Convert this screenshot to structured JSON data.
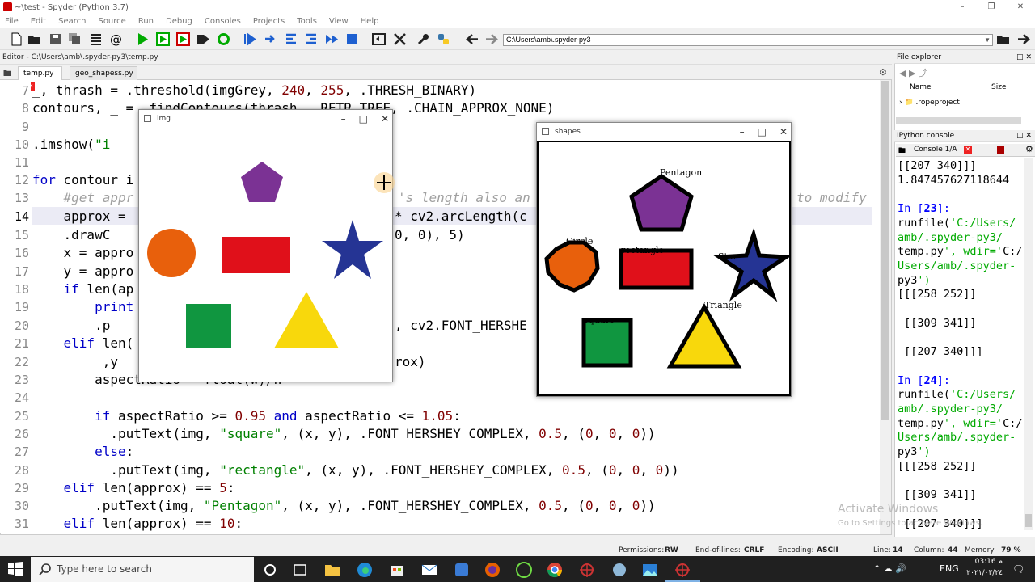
{
  "window": {
    "title": "~\\test - Spyder (Python 3.7)"
  },
  "menu": [
    "File",
    "Edit",
    "Search",
    "Source",
    "Run",
    "Debug",
    "Consoles",
    "Projects",
    "Tools",
    "View",
    "Help"
  ],
  "path": {
    "value": "C:\\Users\\amb\\.spyder-py3"
  },
  "editor": {
    "header": "Editor - C:\\Users\\amb\\.spyder-py3\\temp.py",
    "tabs": [
      "temp.py",
      "geo_shapess.py"
    ],
    "lines": [
      {
        "n": "7",
        "text": "_, thrash = cv2.threshold(imgGrey, 240, 255, cv2.THRESH_BINARY)"
      },
      {
        "n": "8",
        "text": "contours, _ = cv2.findContours(thrash, cv2.RETR_TREE, cv2.CHAIN_APPROX_NONE)"
      },
      {
        "n": "9",
        "text": ""
      },
      {
        "n": "10",
        "text": "cv2.imshow(\"i"
      },
      {
        "n": "11",
        "text": ""
      },
      {
        "n": "12",
        "text": "for contour i"
      },
      {
        "n": "13",
        "text": "    #get appr"
      },
      {
        "n": "14",
        "text": "    approx = "
      },
      {
        "n": "15",
        "text": "    cv2.drawC"
      },
      {
        "n": "16",
        "text": "    x = appro"
      },
      {
        "n": "17",
        "text": "    y = appro"
      },
      {
        "n": "18",
        "text": "    if len(ap"
      },
      {
        "n": "19",
        "text": "        print"
      },
      {
        "n": "20",
        "text": "        cv2.p"
      },
      {
        "n": "21",
        "text": "    elif len("
      },
      {
        "n": "22",
        "text": "        x1 ,y"
      },
      {
        "n": "23",
        "text": "        aspectRatio = float(w)/h"
      },
      {
        "n": "24",
        "text": ""
      },
      {
        "n": "25",
        "text": "        if aspectRatio >= 0.95 and aspectRatio <= 1.05:"
      },
      {
        "n": "26",
        "text": "          cv2.putText(img, \"square\", (x, y), cv2.FONT_HERSHEY_COMPLEX, 0.5, (0, 0, 0))"
      },
      {
        "n": "27",
        "text": "        else:"
      },
      {
        "n": "28",
        "text": "          cv2.putText(img, \"rectangle\", (x, y), cv2.FONT_HERSHEY_COMPLEX, 0.5, (0, 0, 0))"
      },
      {
        "n": "29",
        "text": "    elif len(approx) == 5:"
      },
      {
        "n": "30",
        "text": "        cv2.putText(img, \"Pentagon\", (x, y), cv2.FONT_HERSHEY_COMPLEX, 0.5, (0, 0, 0))"
      },
      {
        "n": "31",
        "text": "    elif len(approx) == 10:"
      }
    ],
    "fragments": {
      "l13": "'s length also an",
      "l13b": "to modify",
      "l14": "* cv2.arcLength(c",
      "l15": "0, 0), 5)",
      "l20": ", cv2.FONT_HERSHE",
      "l22": "rox)"
    }
  },
  "file_explorer": {
    "title": "File explorer",
    "col_name": "Name",
    "col_size": "Size",
    "item": ".ropeproject"
  },
  "ipython": {
    "title": "IPython console",
    "tab": "Console 1/A",
    "lines": [
      {
        "t": "[[207 340]]]",
        "c": ""
      },
      {
        "t": "1.847457627118644",
        "c": ""
      },
      {
        "t": "",
        "c": ""
      },
      {
        "t": "In [23]:",
        "c": "cin"
      },
      {
        "t": "runfile('C:/Users/",
        "c": "mix"
      },
      {
        "t": "amb/.spyder-py3/",
        "c": "cstr"
      },
      {
        "t": "temp.py', wdir='C:/",
        "c": "mix"
      },
      {
        "t": "Users/amb/.spyder-",
        "c": "cstr"
      },
      {
        "t": "py3')",
        "c": "mix"
      },
      {
        "t": "[[[258 252]]",
        "c": ""
      },
      {
        "t": "",
        "c": ""
      },
      {
        "t": " [[309 341]]",
        "c": ""
      },
      {
        "t": "",
        "c": ""
      },
      {
        "t": " [[207 340]]]",
        "c": ""
      },
      {
        "t": "",
        "c": ""
      },
      {
        "t": "In [24]:",
        "c": "cin"
      },
      {
        "t": "runfile('C:/Users/",
        "c": "mix"
      },
      {
        "t": "amb/.spyder-py3/",
        "c": "cstr"
      },
      {
        "t": "temp.py', wdir='C:/",
        "c": "mix"
      },
      {
        "t": "Users/amb/.spyder-",
        "c": "cstr"
      },
      {
        "t": "py3')",
        "c": "mix"
      },
      {
        "t": "[[[258 252]]",
        "c": ""
      },
      {
        "t": "",
        "c": ""
      },
      {
        "t": " [[309 341]]",
        "c": ""
      },
      {
        "t": "",
        "c": ""
      },
      {
        "t": " [[207 340]]]",
        "c": ""
      }
    ]
  },
  "img_window": {
    "title": "img"
  },
  "shapes_window": {
    "title": "shapes",
    "labels": {
      "pentagon": "Pentagon",
      "circle": "Circle",
      "rectangle": "rectangle",
      "star": "Star",
      "triangle": "Triangle",
      "square": "square"
    }
  },
  "watermark": {
    "line1": "Activate Windows",
    "line2": "Go to Settings to activate Windows."
  },
  "status": {
    "permissions_label": "Permissions:",
    "permissions": "RW",
    "eol_label": "End-of-lines:",
    "eol": "CRLF",
    "encoding_label": "Encoding:",
    "encoding": "ASCII",
    "line_label": "Line:",
    "line": "14",
    "column_label": "Column:",
    "column": "44",
    "memory_label": "Memory:",
    "memory": "79 %"
  },
  "taskbar": {
    "search_placeholder": "Type here to search",
    "lang": "ENG",
    "time": "03:16 م",
    "date": "٢٠٢١/٠٣/٢٤"
  },
  "colors": {
    "pentagon": "#7b3294",
    "circle": "#e8600c",
    "rectangle": "#e0101a",
    "star": "#253494",
    "square": "#109640",
    "triangle": "#f8d80c"
  }
}
